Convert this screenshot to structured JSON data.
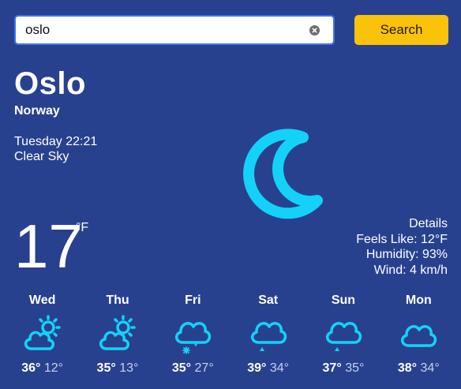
{
  "search": {
    "value": "oslo",
    "button_label": "Search"
  },
  "location": {
    "city": "Oslo",
    "country": "Norway"
  },
  "current": {
    "datetime": "Tuesday 22:21",
    "condition": "Clear Sky",
    "temperature": "17",
    "unit": "°F",
    "icon": "moon-icon"
  },
  "details": {
    "title": "Details",
    "feels_like": "Feels Like: 12°F",
    "humidity": "Humidity: 93%",
    "wind": "Wind: 4 km/h"
  },
  "forecast": [
    {
      "day": "Wed",
      "high": "36°",
      "low": "12°",
      "icon": "partly-cloudy-icon"
    },
    {
      "day": "Thu",
      "high": "35°",
      "low": "13°",
      "icon": "partly-cloudy-icon"
    },
    {
      "day": "Fri",
      "high": "35°",
      "low": "27°",
      "icon": "snow-icon"
    },
    {
      "day": "Sat",
      "high": "39°",
      "low": "34°",
      "icon": "rain-icon"
    },
    {
      "day": "Sun",
      "high": "37°",
      "low": "35°",
      "icon": "rain-icon"
    },
    {
      "day": "Mon",
      "high": "38°",
      "low": "34°",
      "icon": "cloud-icon"
    }
  ],
  "colors": {
    "background": "#28418f",
    "accent": "#14d2f7",
    "button": "#fbc20a"
  }
}
